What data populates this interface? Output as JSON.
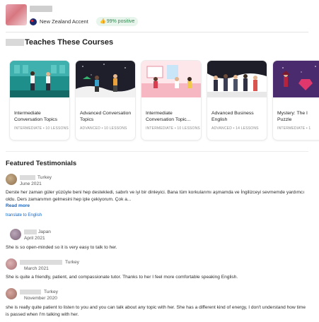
{
  "header": {
    "accent_label": "New Zealand Accent",
    "positive_label": "99% positive",
    "colors": {
      "positive_bg": "#e7f5ec",
      "positive_text": "#2d8a4e"
    }
  },
  "courses": {
    "title": "Teaches These Courses",
    "items": [
      {
        "title": "Intermediate Conversation Topics",
        "meta": "INTERMEDIATE • 10 LESSONS"
      },
      {
        "title": "Advanced Conversation Topics",
        "meta": "ADVANCED • 10 LESSONS"
      },
      {
        "title": "Intermediate Conversation Topic...",
        "meta": "INTERMEDIATE • 10 LESSONS"
      },
      {
        "title": "Advanced Business English",
        "meta": "ADVANCED • 14 LESSONS"
      },
      {
        "title": "Mystery: The I Puzzle",
        "meta": "INTERMEDIATE • 1"
      }
    ]
  },
  "testimonials": {
    "title": "Featured Testimonials",
    "items": [
      {
        "country": "Turkey",
        "date": "June 2021",
        "text": "Derste her zaman güler yüzüyle beni hep destekledi, sabırlı ve iyi bir dinleyici. Bana tüm korkularımı aşmamda ve İngilizceyi sevmemde yardımcı oldu. Ders zamanımın gelmesini hep iple çekiyorum. Çok a...",
        "read_more": "Read more",
        "translate": "translate to English"
      },
      {
        "country": "Japan",
        "date": "April 2021",
        "text": "She is so open-minded so it is very easy to talk to her."
      },
      {
        "country": "Turkey",
        "date": "March 2021",
        "text": "She is quite a friendly, patient, and compassionate tutor. Thanks to her I feel more comfortable speaking English."
      },
      {
        "country": "Turkey",
        "date": "November 2020",
        "text": "she is really quite patient to listen to you and you can talk about any topic with her. She has a different kind of energy, I don't understand how time is passed when I'm talking with her."
      }
    ]
  },
  "icons": {
    "flag": "new-zealand-flag-icon",
    "thumb": "thumbs-up-icon"
  }
}
